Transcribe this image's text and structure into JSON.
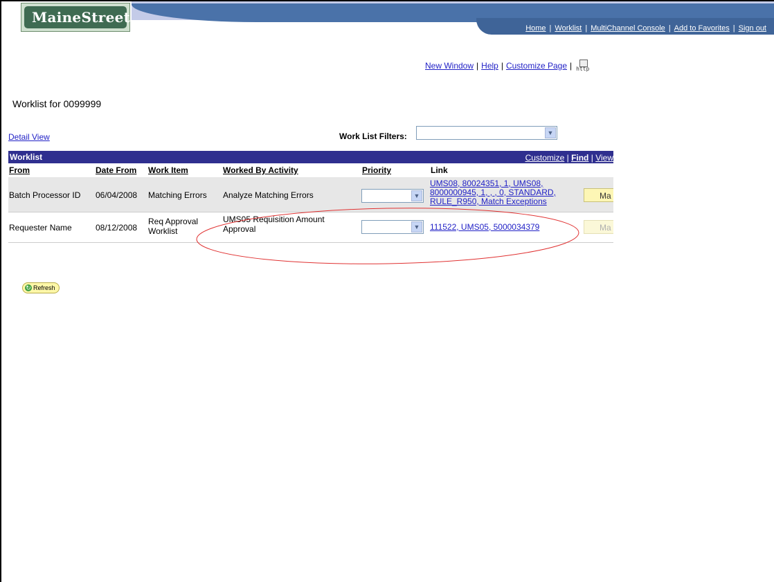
{
  "header": {
    "logo_text": "MaineStreet",
    "nav": [
      {
        "label": "Home"
      },
      {
        "label": "Worklist"
      },
      {
        "label": "MultiChannel Console"
      },
      {
        "label": "Add to Favorites"
      },
      {
        "label": "Sign out"
      }
    ]
  },
  "page_links": {
    "new_window": "New Window",
    "help": "Help",
    "customize_page": "Customize Page",
    "http_icon_text": "http"
  },
  "page_title": "Worklist for 0099999",
  "detail_view": "Detail View",
  "filters": {
    "label": "Work List Filters:",
    "value": ""
  },
  "grid": {
    "title": "Worklist",
    "tools": {
      "customize": "Customize",
      "find": "Find",
      "view": "View"
    },
    "columns": {
      "from": "From",
      "date_from": "Date From",
      "work_item": "Work Item",
      "worked_by_activity": "Worked By Activity",
      "priority": "Priority",
      "link": "Link"
    },
    "rows": [
      {
        "from": "Batch Processor ID",
        "date_from": "06/04/2008",
        "work_item": "Matching Errors",
        "activity": "Analyze Matching Errors",
        "priority": "",
        "link_lines": [
          "UMS08, 80024351, 1, UMS08,",
          "8000000945, 1, , , 0, STANDARD,",
          "RULE_R950, Match Exceptions"
        ],
        "button": "Ma"
      },
      {
        "from": "Requester Name",
        "date_from": "08/12/2008",
        "work_item_lines": [
          "Req Approval",
          "Worklist"
        ],
        "activity_lines": [
          "UMS05 Requisition Amount",
          "Approval"
        ],
        "priority": "",
        "link": "111522, UMS05, 5000034379",
        "button": "Ma"
      }
    ]
  },
  "refresh": "Refresh",
  "colors": {
    "grid_header": "#2f2f8f",
    "link": "#2121c6",
    "annotation": "#e03030",
    "banner": "#4a72a9"
  }
}
